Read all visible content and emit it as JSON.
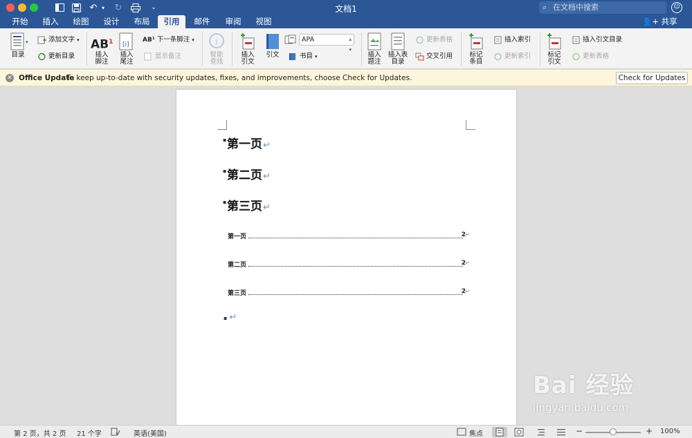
{
  "window": {
    "title": "文档1",
    "search_placeholder": "在文档中搜索",
    "share_label": "共享"
  },
  "tabs": [
    {
      "label": "开始"
    },
    {
      "label": "插入"
    },
    {
      "label": "绘图"
    },
    {
      "label": "设计"
    },
    {
      "label": "布局"
    },
    {
      "label": "引用",
      "active": true
    },
    {
      "label": "邮件"
    },
    {
      "label": "审阅"
    },
    {
      "label": "视图"
    }
  ],
  "ribbon": {
    "toc": "目录",
    "add_text": "添加文字",
    "update_toc": "更新目录",
    "insert_footnote": "插入\n脚注",
    "insert_endnote": "插入\n尾注",
    "next_footnote": "下一条脚注",
    "show_notes": "显示备注",
    "smart_lookup": "智能\n查找",
    "insert_citation": "插入\n引文",
    "citations": "引文",
    "style_value": "APA",
    "bibliography": "书目",
    "insert_caption": "插入\n题注",
    "insert_table_of_figures": "插入表\n目录",
    "update_table": "更新表格",
    "cross_reference": "交叉引用",
    "mark_entry": "标记\n条目",
    "insert_index": "插入索引",
    "update_index": "更新索引",
    "mark_citation": "标记\n引文",
    "insert_table_of_authorities": "插入引文目录",
    "update_table_2": "更新表格"
  },
  "message_bar": {
    "title": "Office Update",
    "text": "To keep up-to-date with security updates, fixes, and improvements, choose Check for Updates.",
    "button": "Check for Updates"
  },
  "document": {
    "headings": [
      "第一页",
      "第二页",
      "第三页"
    ],
    "toc_entries": [
      {
        "label": "第一页",
        "page": "2"
      },
      {
        "label": "第二页",
        "page": "2"
      },
      {
        "label": "第三页",
        "page": "2"
      }
    ],
    "pilcrow": "↵"
  },
  "status": {
    "page_info": "第 2 页，共 2 页",
    "word_count": "21 个字",
    "language": "英语(美国)",
    "focus": "焦点",
    "zoom": "100%"
  },
  "watermark": {
    "main": "Bai 经验",
    "sub": "jingyan.baidu.com"
  },
  "colors": {
    "title_bar": "#2b5797",
    "ribbon": "#f3f3f3",
    "message_bar": "#fdf6dc"
  }
}
